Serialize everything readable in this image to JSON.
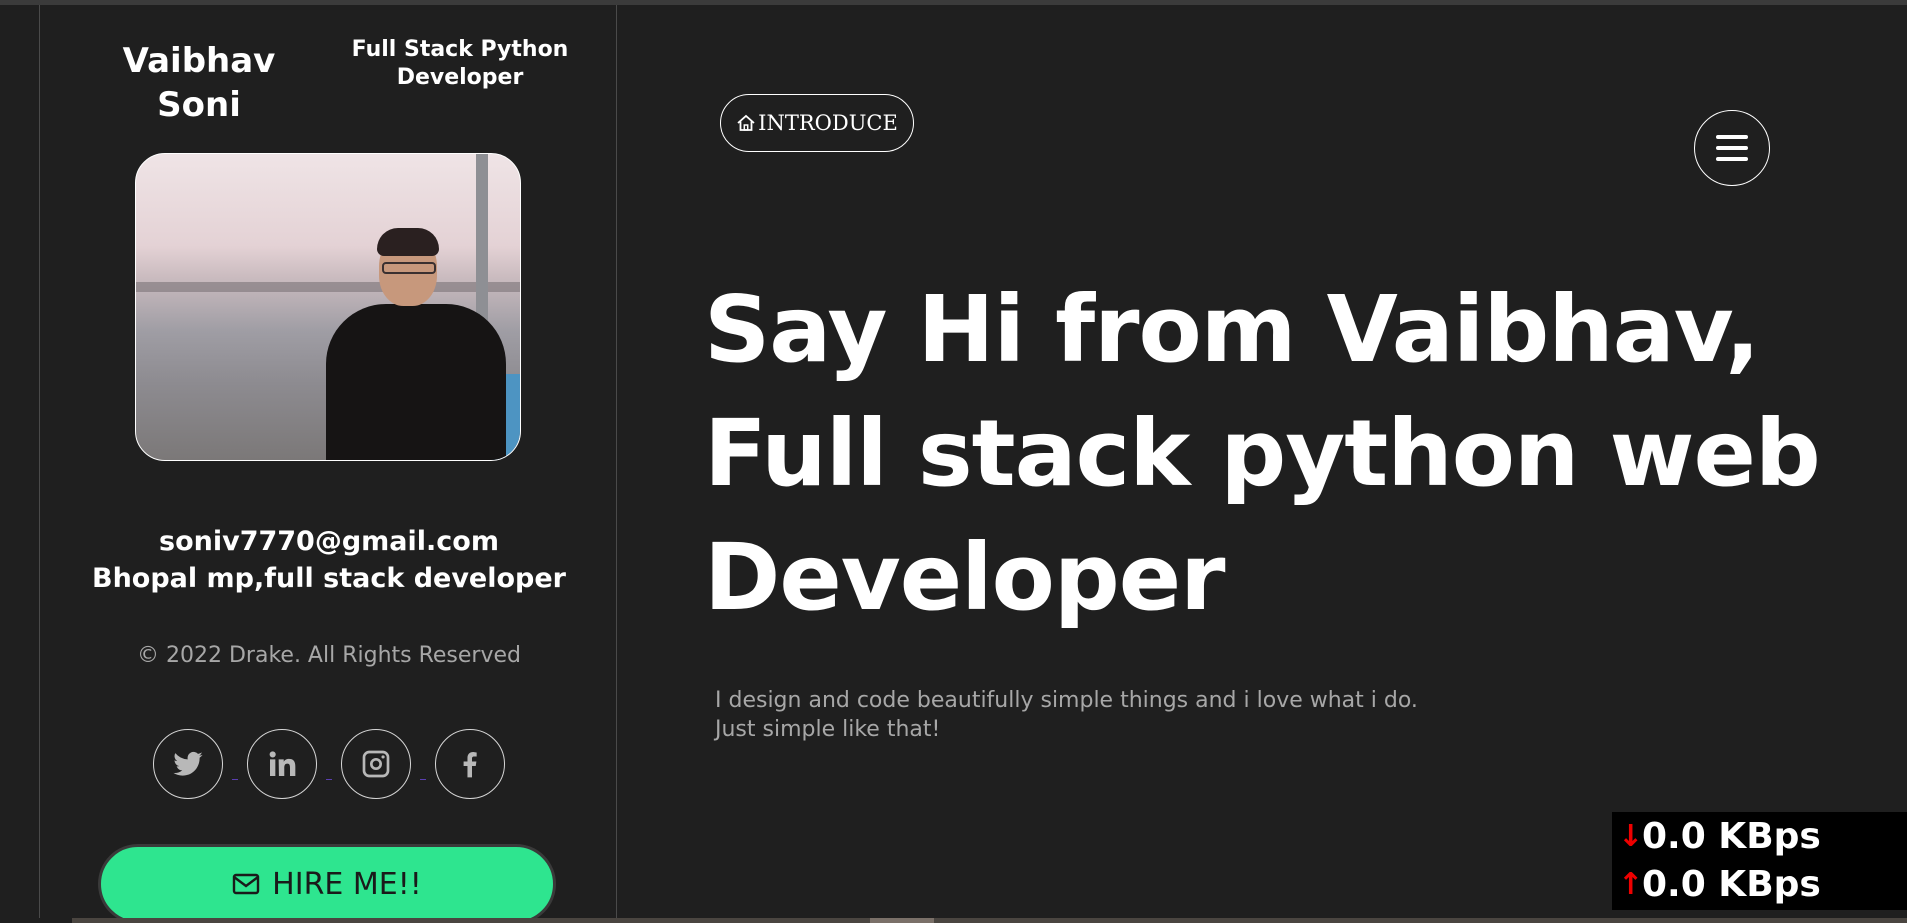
{
  "sidebar": {
    "name_line1": "Vaibhav",
    "name_line2": "Soni",
    "role_line1": "Full Stack Python",
    "role_line2": "Developer",
    "email": "soniv7770@gmail.com",
    "location": "Bhopal mp,full stack developer",
    "copyright": "© 2022 Drake. All Rights Reserved",
    "socials": [
      {
        "icon": "twitter-icon"
      },
      {
        "icon": "linkedin-icon"
      },
      {
        "icon": "instagram-icon"
      },
      {
        "icon": "facebook-icon"
      }
    ],
    "hire_label": "HIRE ME!!"
  },
  "main": {
    "intro_label": "INTRODUCE",
    "headline_line1": "Say Hi from Vaibhav,",
    "headline_line2": "Full stack python web",
    "headline_line3": "Developer",
    "tagline_line1": "I design and code beautifully simple things and i love what i do.",
    "tagline_line2": "Just simple like that!"
  },
  "netmeter": {
    "download": "0.0 KBps",
    "upload": "0.0 KBps"
  },
  "colors": {
    "background": "#1f1f1f",
    "accent": "#2ee58f",
    "muted_text": "#a7a7a7"
  }
}
